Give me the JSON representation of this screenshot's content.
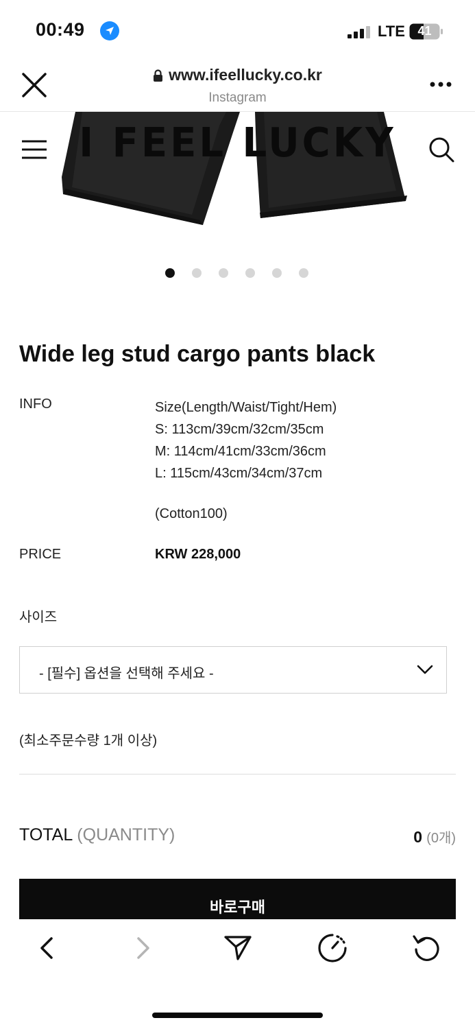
{
  "status_bar": {
    "time": "00:49",
    "network": "LTE",
    "battery": "41"
  },
  "browser": {
    "url": "www.ifeellucky.co.kr",
    "source": "Instagram"
  },
  "header": {
    "brand": "I FEEL LUCKY"
  },
  "carousel": {
    "slide_count": 6,
    "active_index": 0
  },
  "product": {
    "title": "Wide leg stud cargo pants black",
    "info_label": "INFO",
    "info_lines": [
      "Size(Length/Waist/Tight/Hem)",
      "S: 113cm/39cm/32cm/35cm",
      "M: 114cm/41cm/33cm/36cm",
      "L: 115cm/43cm/34cm/37cm"
    ],
    "material": "(Cotton100)",
    "price_label": "PRICE",
    "price": "KRW 228,000"
  },
  "options": {
    "size_label": "사이즈",
    "select_placeholder": "- [필수] 옵션을 선택해 주세요 -",
    "min_order": "(최소주문수량 1개 이상)"
  },
  "total": {
    "label": "TOTAL",
    "qty_label": "(QUANTITY)",
    "amount": "0",
    "count": "(0개)"
  },
  "buy_button": "바로구매",
  "colors": {
    "accent_blue": "#1a8cff",
    "button_black": "#0c0c0c",
    "muted_gray": "#8a8a8a"
  }
}
